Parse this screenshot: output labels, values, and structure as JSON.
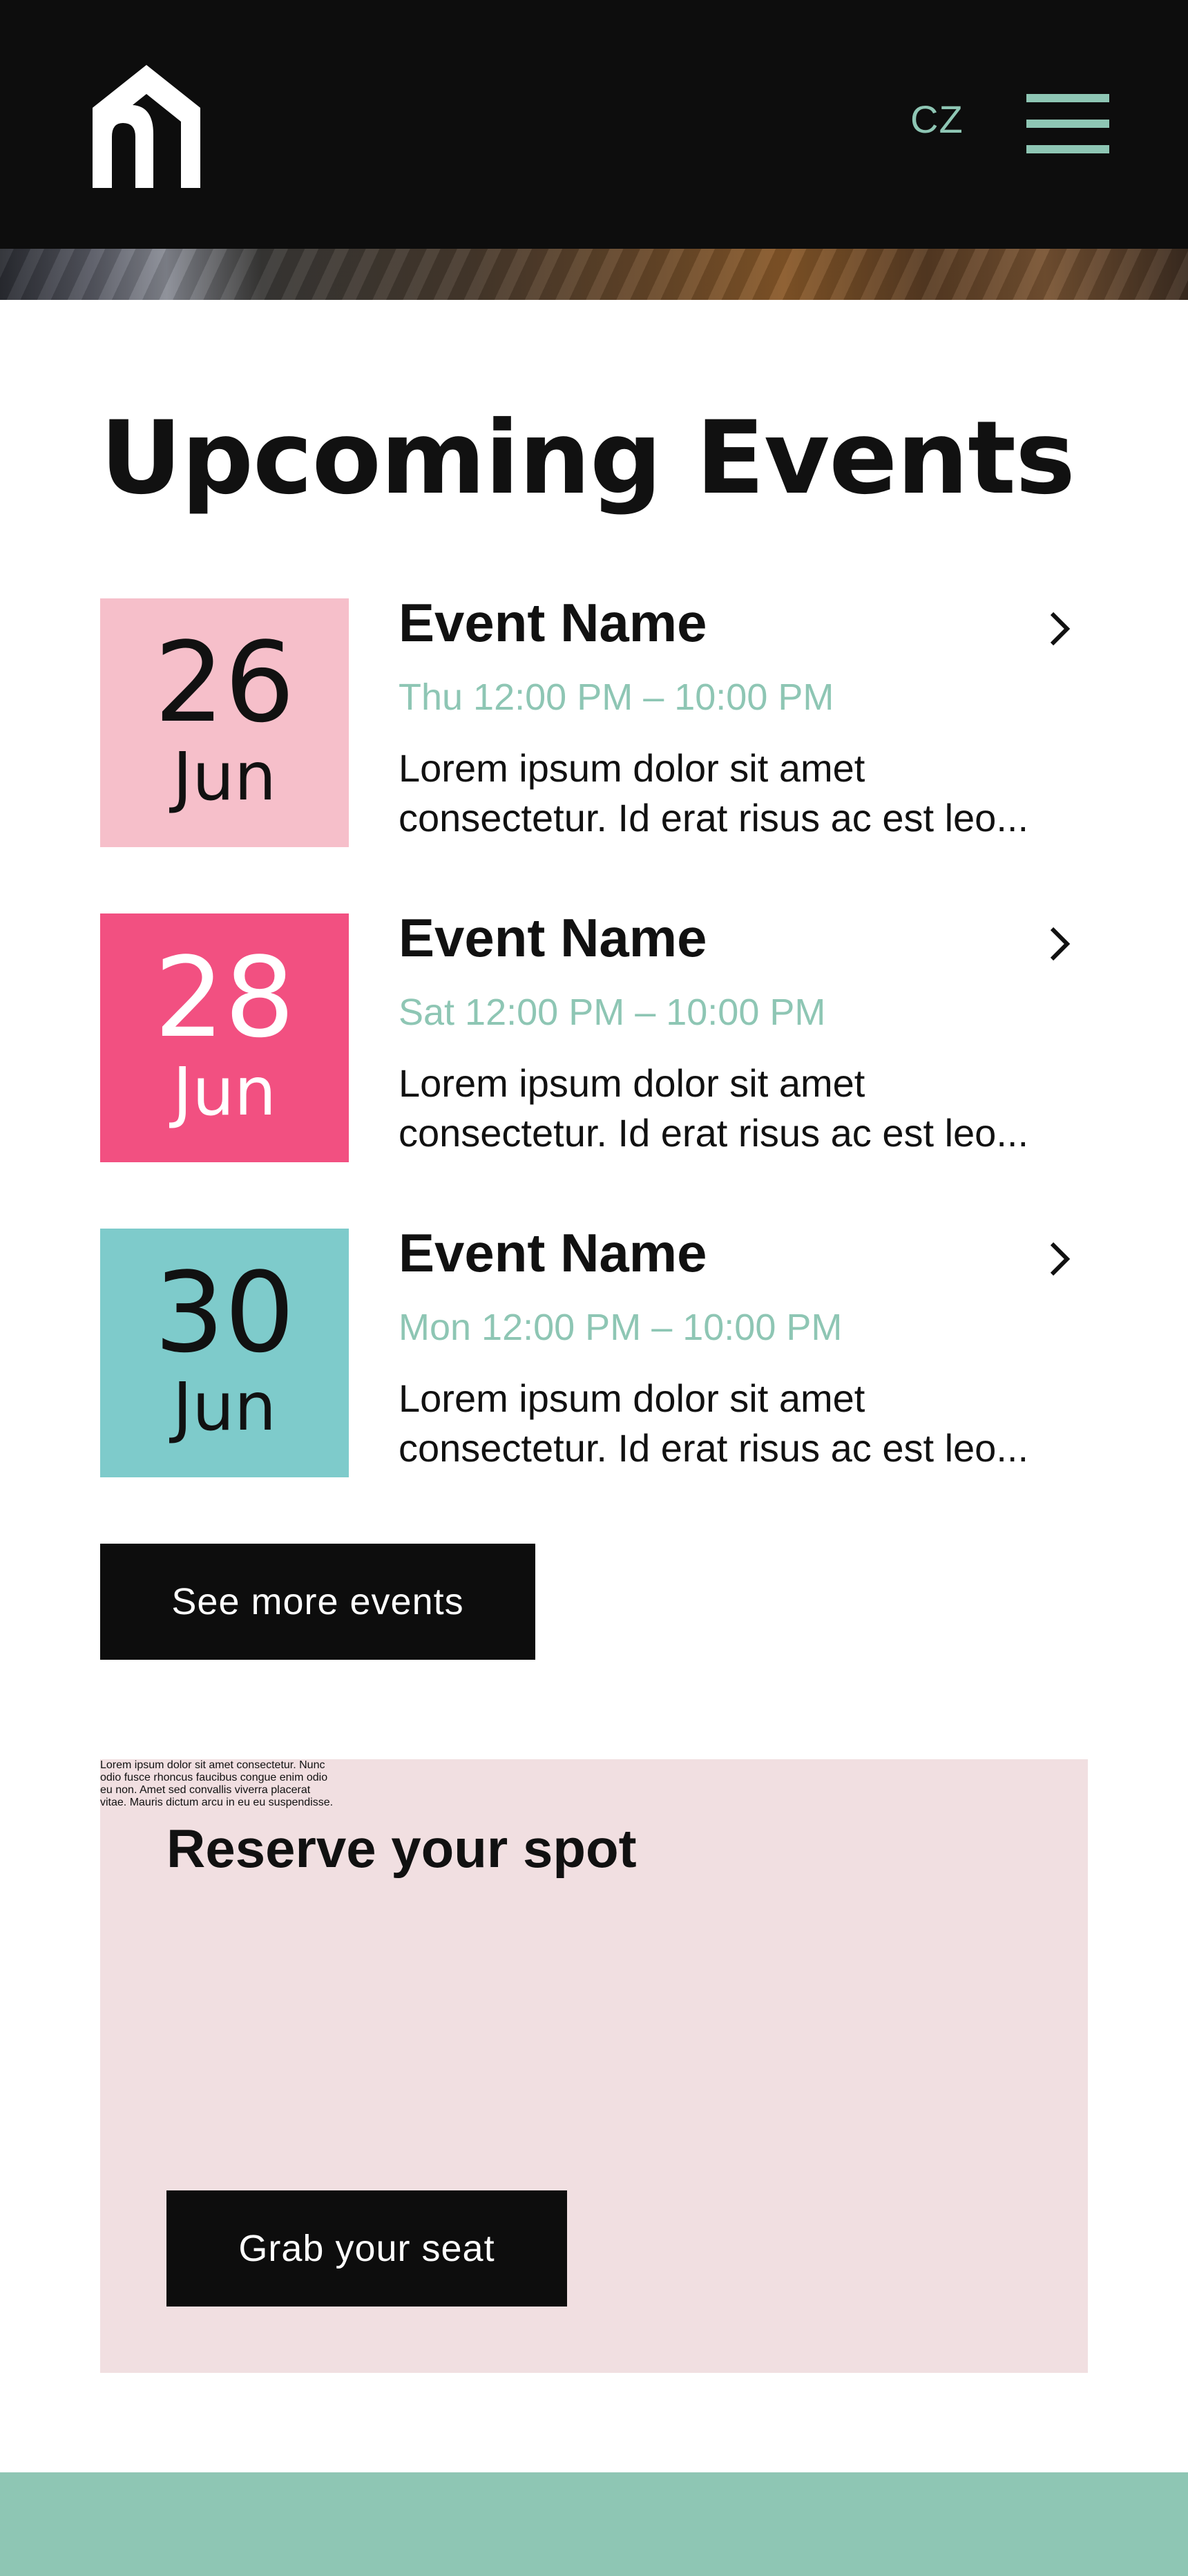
{
  "header": {
    "language": "CZ",
    "logo_icon": "house-arch-logo-icon",
    "menu_icon": "hamburger-menu-icon",
    "accent_color": "#8ec6b4"
  },
  "section": {
    "title": "Upcoming Events"
  },
  "events": [
    {
      "day": "26",
      "month": "Jun",
      "name": "Event Name",
      "time": "Thu 12:00 PM – 10:00 PM",
      "desc_line1": "Lorem ipsum dolor sit amet",
      "desc_line2": "consectetur. Id erat risus ac est leo...",
      "color": "#f6bfca"
    },
    {
      "day": "28",
      "month": "Jun",
      "name": "Event Name",
      "time": "Sat 12:00 PM – 10:00 PM",
      "desc_line1": "Lorem ipsum dolor sit amet",
      "desc_line2": "consectetur. Id erat risus ac est leo...",
      "color": "#f25081"
    },
    {
      "day": "30",
      "month": "Jun",
      "name": "Event Name",
      "time": "Mon 12:00 PM – 10:00 PM",
      "desc_line1": "Lorem ipsum dolor sit amet",
      "desc_line2": "consectetur. Id erat risus ac est leo...",
      "color": "#7ecbcb"
    }
  ],
  "see_more_label": "See more events",
  "reserve": {
    "title": "Reserve your spot",
    "line1": "Lorem ipsum dolor sit amet consectetur. Nunc",
    "line2": "odio fusce rhoncus faucibus congue enim odio",
    "line3": "eu non. Amet sed convallis viverra placerat",
    "line4": "vitae. Mauris dictum arcu in eu eu suspendisse.",
    "button_label": "Grab your seat",
    "background": "#f1dfe1"
  }
}
